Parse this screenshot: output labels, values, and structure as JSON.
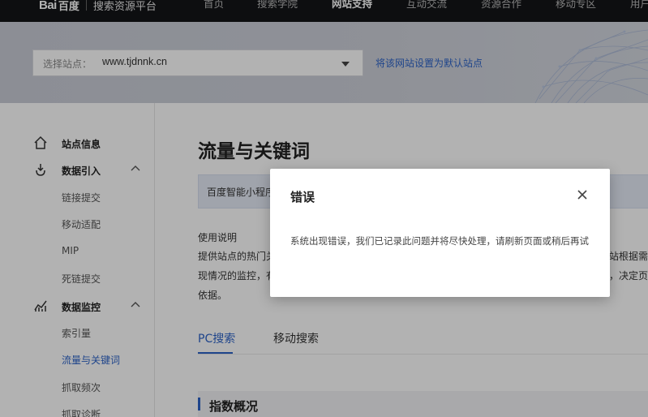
{
  "topnav": {
    "logo_mark": "Bai",
    "logo_sub": "百度",
    "platform": "搜索资源平台",
    "items": [
      {
        "label": "首页"
      },
      {
        "label": "搜索学院"
      },
      {
        "label": "网站支持"
      },
      {
        "label": "互动交流"
      },
      {
        "label": "资源合作"
      },
      {
        "label": "移动专区"
      },
      {
        "label": "用户"
      }
    ],
    "active_index": 2
  },
  "banner": {
    "site_label": "选择站点：",
    "site_value": "www.tjdnnk.cn",
    "default_link": "将该网站设置为默认站点"
  },
  "sidebar": {
    "groups": [
      {
        "label": "站点信息",
        "icon": "home-icon"
      },
      {
        "label": "数据引入",
        "icon": "data-import-icon",
        "items": [
          {
            "label": "链接提交"
          },
          {
            "label": "移动适配"
          },
          {
            "label": "MIP"
          },
          {
            "label": "死链提交"
          }
        ]
      },
      {
        "label": "数据监控",
        "icon": "data-monitor-icon",
        "items": [
          {
            "label": "索引量"
          },
          {
            "label": "流量与关键词"
          },
          {
            "label": "抓取频次"
          },
          {
            "label": "抓取诊断"
          }
        ]
      }
    ]
  },
  "main": {
    "title": "流量与关键词",
    "tabstrip_text": "百度智能小程序",
    "usage_title": "使用说明",
    "usage_lines": [
      "提供站点的热门关",
      "站根据需求",
      "现情况的监控，有",
      "，决定页面",
      "依据。"
    ],
    "search_tabs": [
      {
        "label": "PC搜索"
      },
      {
        "label": "移动搜索"
      }
    ],
    "overview_title": "指数概况"
  },
  "modal": {
    "title": "错误",
    "message": "系统出现错误，我们已记录此问题并将尽快处理，请刷新页面或稍后再试"
  },
  "colors": {
    "accent": "#2d63c8",
    "topnav_bg": "#141518"
  }
}
